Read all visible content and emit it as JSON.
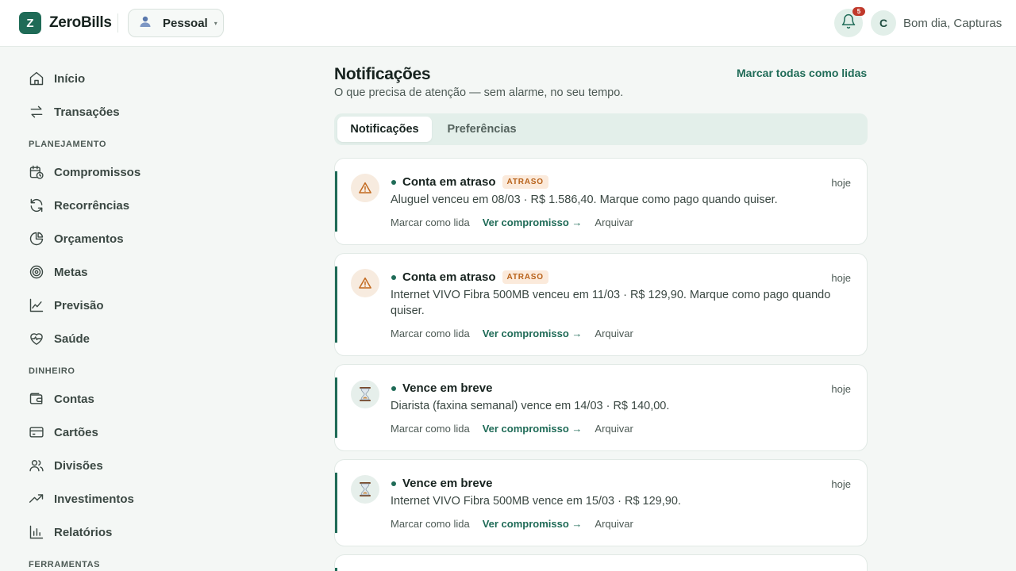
{
  "header": {
    "logo_letter": "Z",
    "brand": "ZeroBills",
    "profile": {
      "label": "Pessoal",
      "caret": "▾",
      "icon": "user-icon"
    },
    "notifications_count": "5",
    "avatar_letter": "C",
    "greeting": "Bom dia, Capturas"
  },
  "sidebar": {
    "items": [
      {
        "label": "Início",
        "icon": "home-icon"
      },
      {
        "label": "Transações",
        "icon": "transfer-icon"
      },
      {
        "label": "Compromissos",
        "icon": "calendar-clock-icon"
      },
      {
        "label": "Recorrências",
        "icon": "refresh-icon"
      },
      {
        "label": "Orçamentos",
        "icon": "pie-chart-icon"
      },
      {
        "label": "Metas",
        "icon": "target-icon"
      },
      {
        "label": "Previsão",
        "icon": "line-chart-icon"
      },
      {
        "label": "Saúde",
        "icon": "heart-pulse-icon"
      },
      {
        "label": "Contas",
        "icon": "wallet-icon"
      },
      {
        "label": "Cartões",
        "icon": "credit-card-icon"
      },
      {
        "label": "Divisões",
        "icon": "users-icon"
      },
      {
        "label": "Investimentos",
        "icon": "trending-up-icon"
      },
      {
        "label": "Relatórios",
        "icon": "bar-chart-icon"
      }
    ],
    "sections": [
      "PLANEJAMENTO",
      "DINHEIRO",
      "FERRAMENTAS"
    ]
  },
  "main": {
    "title": "Notificações",
    "subtitle": "O que precisa de atenção — sem alarme, no seu tempo.",
    "mark_all": "Marcar todas como lidas",
    "tabs": [
      {
        "label": "Notificações",
        "active": true
      },
      {
        "label": "Preferências",
        "active": false
      }
    ],
    "actions": {
      "mark_read": "Marcar como lida",
      "view": "Ver compromisso →",
      "archive": "Arquivar"
    },
    "notifications": [
      {
        "type": "overdue",
        "icon": "warning-icon",
        "title": "Conta em atraso",
        "badge": "ATRASO",
        "time": "hoje",
        "body": "Aluguel venceu em 08/03 · R$ 1.586,40. Marque como pago quando quiser."
      },
      {
        "type": "overdue",
        "icon": "warning-icon",
        "title": "Conta em atraso",
        "badge": "ATRASO",
        "time": "hoje",
        "body": "Internet VIVO Fibra 500MB venceu em 11/03 · R$ 129,90. Marque como pago quando quiser."
      },
      {
        "type": "due-soon",
        "icon": "hourglass-icon",
        "title": "Vence em breve",
        "time": "hoje",
        "body": "Diarista (faxina semanal) vence em 14/03 · R$ 140,00."
      },
      {
        "type": "due-soon",
        "icon": "hourglass-icon",
        "title": "Vence em breve",
        "time": "hoje",
        "body": "Internet VIVO Fibra 500MB vence em 15/03 · R$ 129,90."
      }
    ]
  },
  "colors": {
    "accent": "#1f6b57",
    "warning": "#b8621a",
    "badge": "#c0392b",
    "background": "#f4f7f5"
  }
}
